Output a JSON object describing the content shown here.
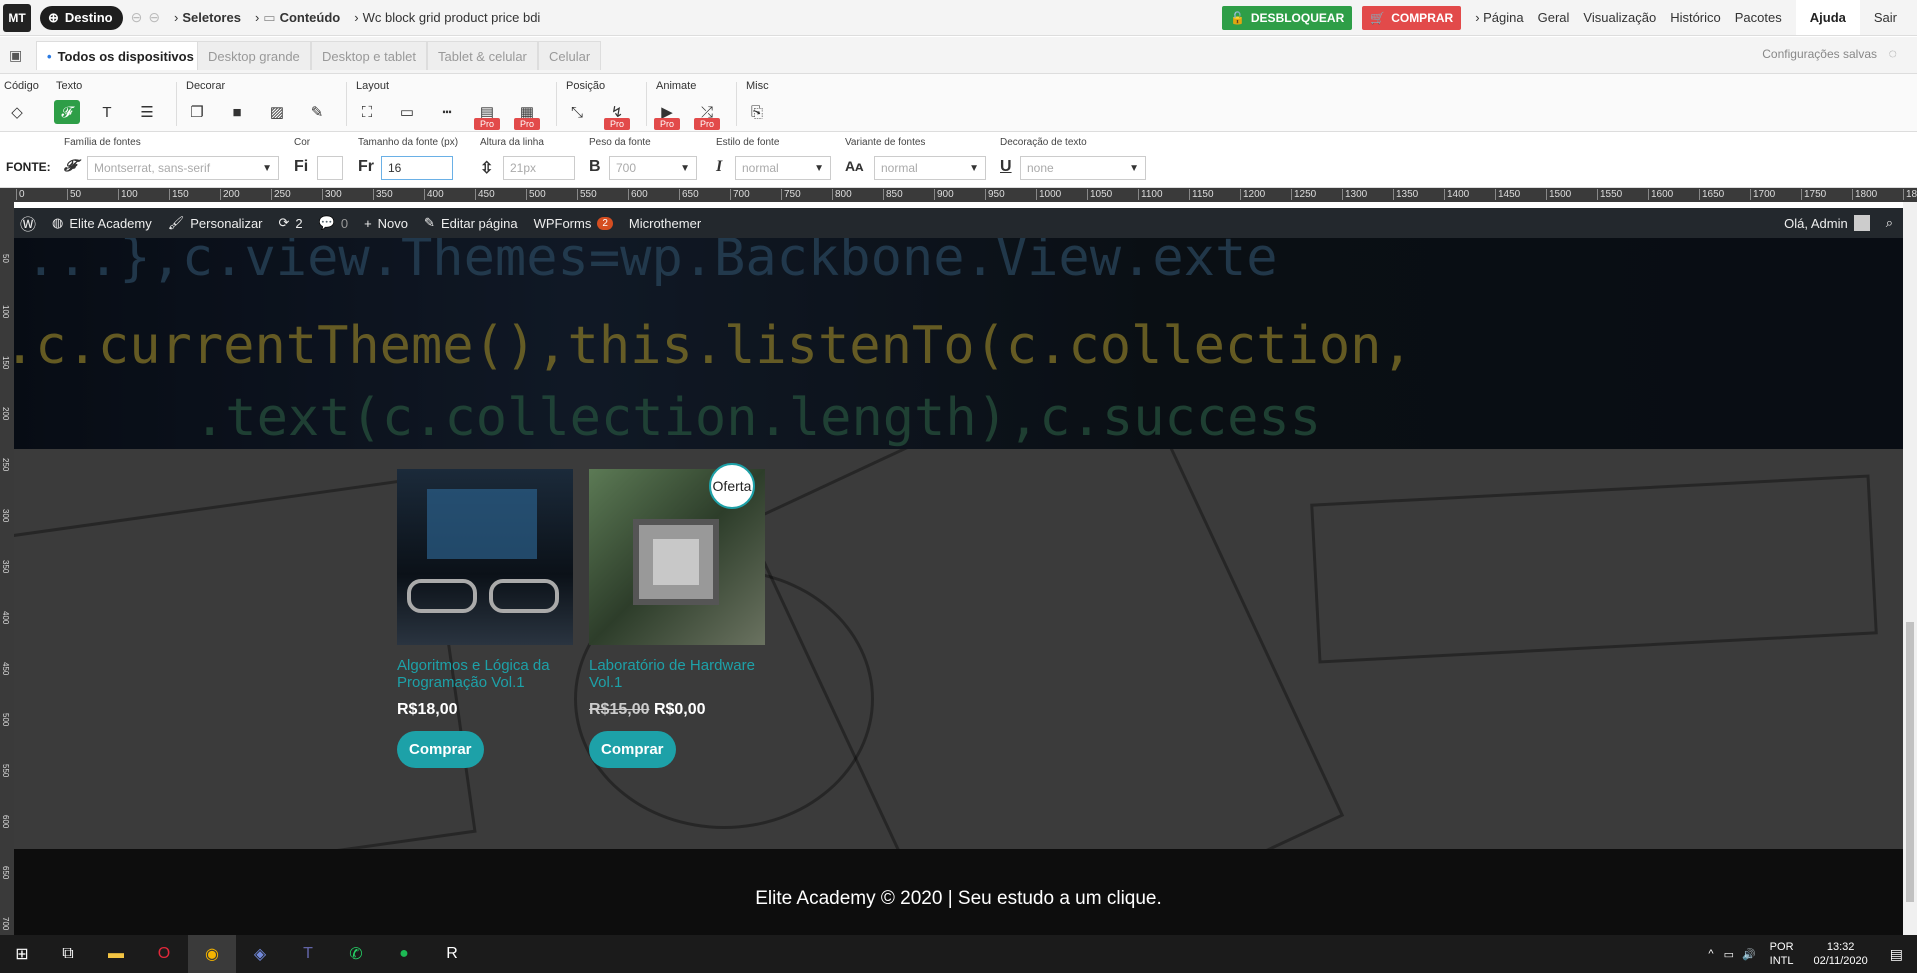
{
  "topbar": {
    "logo": "MT",
    "destino": "Destino",
    "seletores": "Seletores",
    "conteudo": "Conteúdo",
    "selector_path": "Wc block grid product price bdi",
    "desbloquear": "DESBLOQUEAR",
    "comprar": "COMPRAR",
    "menu": [
      "Página",
      "Geral",
      "Visualização",
      "Histórico",
      "Pacotes",
      "Ajuda",
      "Sair"
    ]
  },
  "devices": {
    "tabs": [
      "Todos os dispositivos",
      "Desktop grande",
      "Desktop e tablet",
      "Tablet & celular",
      "Celular"
    ],
    "status": "Configurações salvas"
  },
  "toolbar": {
    "groups": [
      "Código",
      "Texto",
      "Decorar",
      "Layout",
      "Posição",
      "Animate",
      "Misc"
    ],
    "pro_label": "Pro"
  },
  "fontrow": {
    "prefix": "FONTE:",
    "family_label": "Família de fontes",
    "family_placeholder": "Montserrat, sans-serif",
    "color_label": "Cor",
    "size_label": "Tamanho da fonte (px)",
    "size_value": "16",
    "line_label": "Altura da linha",
    "line_placeholder": "21px",
    "weight_label": "Peso da fonte",
    "weight_placeholder": "700",
    "style_label": "Estilo de fonte",
    "style_placeholder": "normal",
    "variant_label": "Variante de fontes",
    "variant_placeholder": "normal",
    "decoration_label": "Decoração de texto",
    "decoration_placeholder": "none"
  },
  "ruler": {
    "ticks": [
      "0",
      "50",
      "100",
      "150",
      "200",
      "250",
      "300",
      "350",
      "400",
      "450",
      "500",
      "550",
      "600",
      "650",
      "700",
      "750",
      "800",
      "850",
      "900",
      "950",
      "1000",
      "1050",
      "1100",
      "1150",
      "1200",
      "1250",
      "1300",
      "1350",
      "1400",
      "1450",
      "1500",
      "1550",
      "1600",
      "1650",
      "1700",
      "1750",
      "1800",
      "1850"
    ],
    "vticks": [
      "50",
      "100",
      "150",
      "200",
      "250",
      "300",
      "350",
      "400",
      "450",
      "500",
      "550",
      "600",
      "650",
      "700"
    ]
  },
  "wpbar": {
    "site": "Elite Academy",
    "personalizar": "Personalizar",
    "updates": "2",
    "comments": "0",
    "novo": "Novo",
    "editar": "Editar página",
    "wpforms": "WPForms",
    "wpforms_badge": "2",
    "microthemer": "Microthemer",
    "greeting": "Olá, Admin"
  },
  "hero": {
    "code_lines": [
      "....},c.view.Themes=wp.Backbone.View.exte",
      ".c.currentTheme(),this.listenTo(c.collection,",
      ".text(c.collection.length),c.success"
    ]
  },
  "products": [
    {
      "title": "Algoritmos e Lógica da Programação Vol.1",
      "price": "R$18,00",
      "old_price": "",
      "button": "Comprar",
      "badge": ""
    },
    {
      "title": "Laboratório de Hardware Vol.1",
      "price": "R$0,00",
      "old_price": "R$15,00",
      "button": "Comprar",
      "badge": "Oferta"
    }
  ],
  "footer": {
    "text": "Elite Academy © 2020 | Seu estudo a um clique."
  },
  "taskbar": {
    "lang": "POR",
    "layout": "INTL",
    "time": "13:32",
    "date": "02/11/2020"
  },
  "colors": {
    "accent_green": "#2e9e47",
    "accent_red": "#e24a4a",
    "teal": "#1da1a8",
    "wpbar": "#23282d"
  }
}
